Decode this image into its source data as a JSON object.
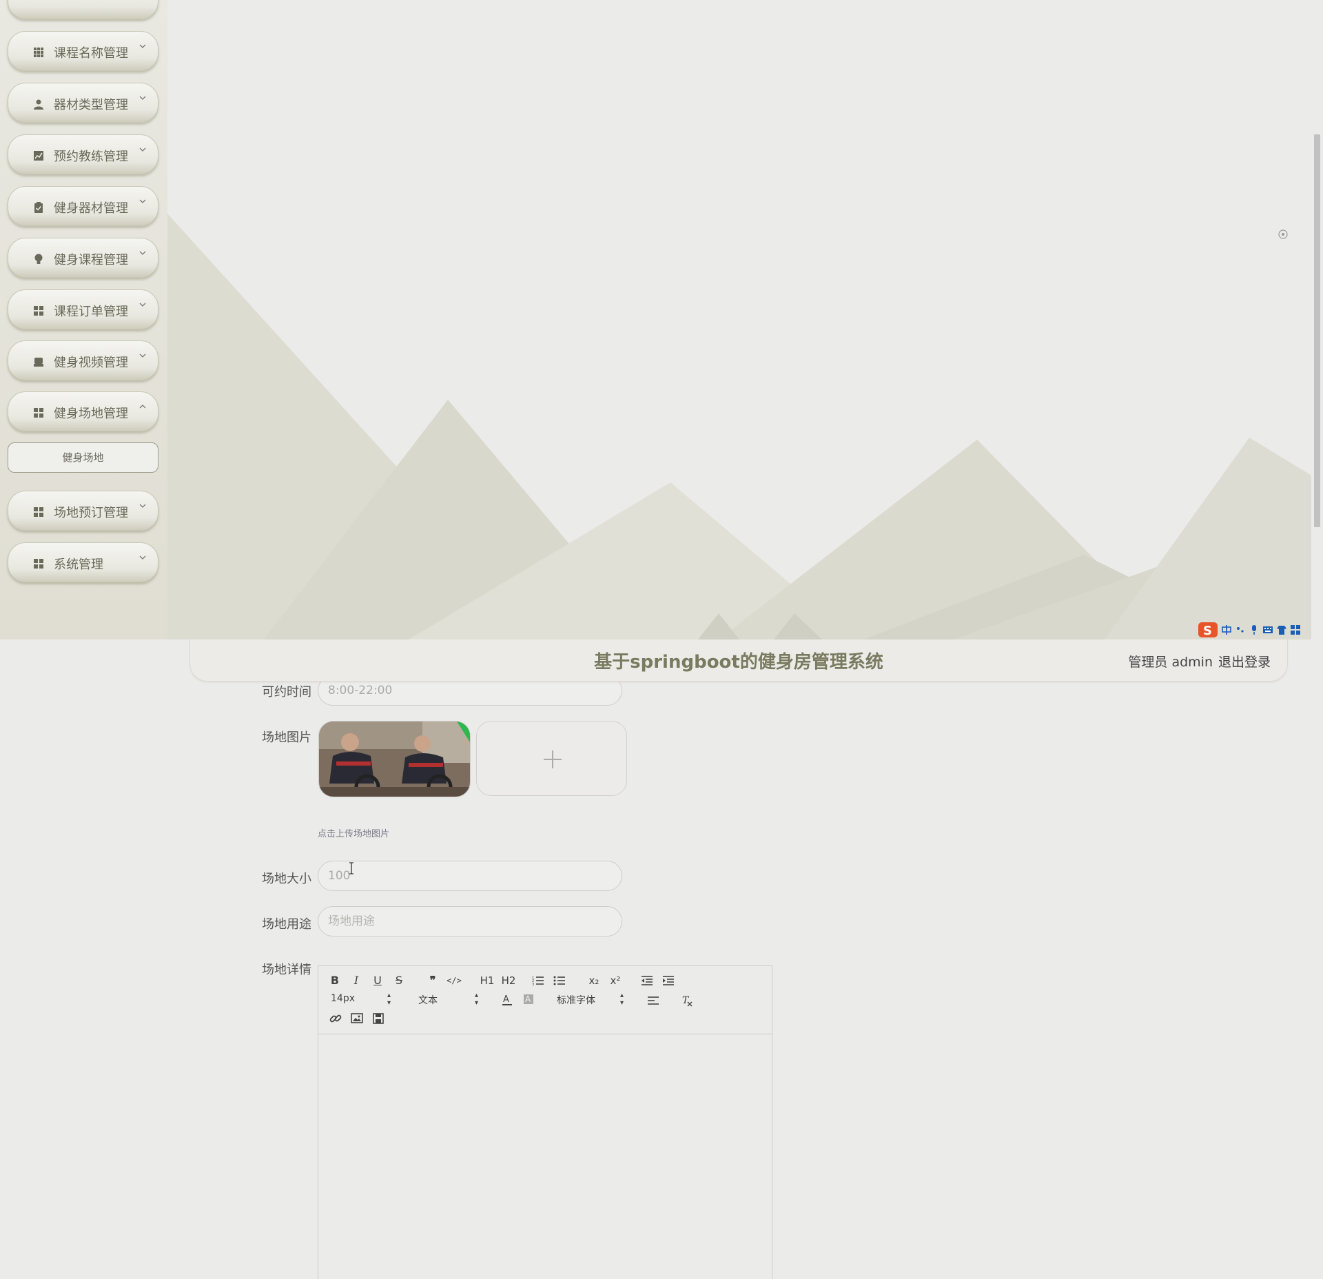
{
  "header": {
    "title": "基于springboot的健身房管理系统",
    "user_label": "管理员 admin",
    "logout_label": "退出登录"
  },
  "sidebar": {
    "items": [
      {
        "label": "课程名称管理",
        "icon": "grid-icon"
      },
      {
        "label": "器材类型管理",
        "icon": "person-icon"
      },
      {
        "label": "预约教练管理",
        "icon": "chart-icon"
      },
      {
        "label": "健身器材管理",
        "icon": "clipboard-icon"
      },
      {
        "label": "健身课程管理",
        "icon": "lightbulb-icon"
      },
      {
        "label": "课程订单管理",
        "icon": "grid-icon"
      },
      {
        "label": "健身视频管理",
        "icon": "archive-icon"
      },
      {
        "label": "健身场地管理",
        "icon": "grid-icon",
        "expanded": true
      },
      {
        "label": "场地预订管理",
        "icon": "grid-icon"
      },
      {
        "label": "系统管理",
        "icon": "grid-icon"
      }
    ],
    "active_sub": "健身场地"
  },
  "form": {
    "time_label": "可约时间",
    "time_value": "8:00-22:00",
    "image_label": "场地图片",
    "upload_hint": "点击上传场地图片",
    "size_label": "场地大小",
    "size_value": "100",
    "use_label": "场地用途",
    "use_placeholder": "场地用途",
    "detail_label": "场地详情"
  },
  "editor": {
    "font_size": "14px",
    "header_select": "文本",
    "font_family": "标准字体",
    "h1": "H1",
    "h2": "H2",
    "sub": "x₂",
    "sup": "x²"
  },
  "colors": {
    "title": "#7a7a60",
    "sidebar_bg": "#e5e3d8",
    "accent_green": "#2db84d"
  }
}
